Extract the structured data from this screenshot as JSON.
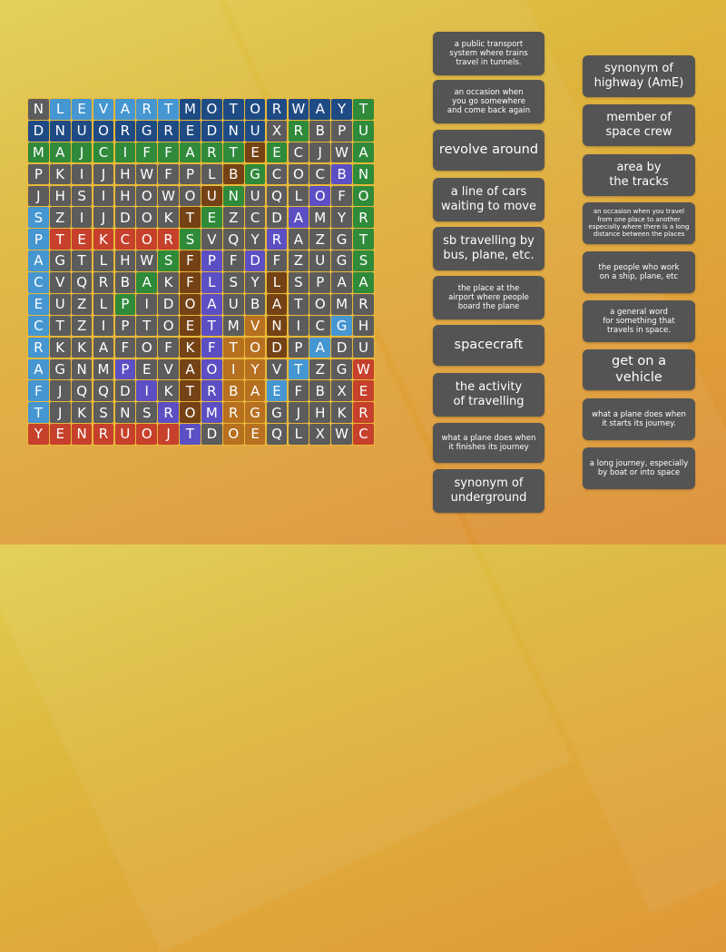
{
  "game": {
    "type": "wordsearch",
    "grid": [
      [
        "N",
        "L",
        "E",
        "V",
        "A",
        "R",
        "T",
        "M",
        "O",
        "T",
        "O",
        "R",
        "W",
        "A",
        "Y",
        "T"
      ],
      [
        "D",
        "N",
        "U",
        "O",
        "R",
        "G",
        "R",
        "E",
        "D",
        "N",
        "U",
        "X",
        "R",
        "B",
        "P",
        "U"
      ],
      [
        "M",
        "A",
        "J",
        "C",
        "I",
        "F",
        "F",
        "A",
        "R",
        "T",
        "E",
        "E",
        "C",
        "J",
        "W",
        "A"
      ],
      [
        "P",
        "K",
        "I",
        "J",
        "H",
        "W",
        "F",
        "P",
        "L",
        "B",
        "G",
        "C",
        "O",
        "C",
        "B",
        "N"
      ],
      [
        "J",
        "H",
        "S",
        "I",
        "H",
        "O",
        "W",
        "O",
        "U",
        "N",
        "U",
        "Q",
        "L",
        "O",
        "F",
        "O"
      ],
      [
        "S",
        "Z",
        "I",
        "J",
        "D",
        "O",
        "K",
        "T",
        "E",
        "Z",
        "C",
        "D",
        "A",
        "M",
        "Y",
        "R"
      ],
      [
        "P",
        "T",
        "E",
        "K",
        "C",
        "O",
        "R",
        "S",
        "V",
        "Q",
        "Y",
        "R",
        "A",
        "Z",
        "G",
        "T"
      ],
      [
        "A",
        "G",
        "T",
        "L",
        "H",
        "W",
        "S",
        "F",
        "P",
        "F",
        "D",
        "F",
        "Z",
        "U",
        "G",
        "S"
      ],
      [
        "C",
        "V",
        "Q",
        "R",
        "B",
        "A",
        "K",
        "F",
        "L",
        "S",
        "Y",
        "L",
        "S",
        "P",
        "A",
        "A"
      ],
      [
        "E",
        "U",
        "Z",
        "L",
        "P",
        "I",
        "D",
        "O",
        "A",
        "U",
        "B",
        "A",
        "T",
        "O",
        "M",
        "R"
      ],
      [
        "C",
        "T",
        "Z",
        "I",
        "P",
        "T",
        "O",
        "E",
        "T",
        "M",
        "V",
        "N",
        "I",
        "C",
        "G",
        "H"
      ],
      [
        "R",
        "K",
        "K",
        "A",
        "F",
        "O",
        "F",
        "K",
        "F",
        "T",
        "O",
        "D",
        "P",
        "A",
        "D",
        "U"
      ],
      [
        "A",
        "G",
        "N",
        "M",
        "P",
        "E",
        "V",
        "A",
        "O",
        "I",
        "Y",
        "V",
        "T",
        "Z",
        "G",
        "W"
      ],
      [
        "F",
        "J",
        "Q",
        "Q",
        "D",
        "I",
        "K",
        "T",
        "R",
        "B",
        "A",
        "E",
        "F",
        "B",
        "X",
        "E"
      ],
      [
        "T",
        "J",
        "K",
        "S",
        "N",
        "S",
        "R",
        "O",
        "M",
        "R",
        "G",
        "G",
        "J",
        "H",
        "K",
        "R"
      ],
      [
        "Y",
        "E",
        "N",
        "R",
        "U",
        "O",
        "J",
        "T",
        "D",
        "O",
        "E",
        "Q",
        "L",
        "X",
        "W",
        "C"
      ]
    ],
    "colors": [
      [
        "g",
        "lb",
        "lb",
        "lb",
        "lb",
        "lb",
        "lb",
        "db",
        "db",
        "db",
        "db",
        "db",
        "db",
        "db",
        "db",
        "gr"
      ],
      [
        "db",
        "db",
        "db",
        "db",
        "db",
        "db",
        "db",
        "db",
        "db",
        "db",
        "db",
        "g",
        "gr",
        "g",
        "g",
        "gr"
      ],
      [
        "gr",
        "gr",
        "gr",
        "gr",
        "gr",
        "gr",
        "gr",
        "gr",
        "gr",
        "gr",
        "br",
        "gr",
        "g",
        "g",
        "g",
        "gr"
      ],
      [
        "g",
        "g",
        "g",
        "g",
        "g",
        "g",
        "g",
        "g",
        "g",
        "br",
        "gr",
        "g",
        "g",
        "g",
        "pu",
        "gr"
      ],
      [
        "g",
        "g",
        "g",
        "g",
        "g",
        "g",
        "g",
        "g",
        "br",
        "gr",
        "g",
        "g",
        "g",
        "pu",
        "g",
        "gr"
      ],
      [
        "lb",
        "g",
        "g",
        "g",
        "g",
        "g",
        "g",
        "br",
        "gr",
        "g",
        "g",
        "g",
        "pu",
        "g",
        "g",
        "gr"
      ],
      [
        "lb",
        "red",
        "red",
        "red",
        "red",
        "red",
        "red",
        "gr",
        "g",
        "g",
        "g",
        "pu",
        "g",
        "g",
        "g",
        "gr"
      ],
      [
        "lb",
        "g",
        "g",
        "g",
        "g",
        "g",
        "gr",
        "br",
        "pu",
        "g",
        "pu",
        "g",
        "g",
        "g",
        "g",
        "gr"
      ],
      [
        "lb",
        "g",
        "g",
        "g",
        "g",
        "gr",
        "g",
        "br",
        "pu",
        "g",
        "g",
        "br",
        "g",
        "g",
        "g",
        "gr"
      ],
      [
        "lb",
        "g",
        "g",
        "g",
        "gr",
        "g",
        "g",
        "br",
        "pu",
        "g",
        "g",
        "br",
        "g",
        "g",
        "g",
        "g"
      ],
      [
        "lb",
        "g",
        "g",
        "g",
        "g",
        "g",
        "g",
        "br",
        "pu",
        "g",
        "or",
        "br",
        "g",
        "g",
        "lb",
        "g"
      ],
      [
        "lb",
        "g",
        "g",
        "g",
        "g",
        "g",
        "g",
        "br",
        "pu",
        "or",
        "or",
        "br",
        "g",
        "lb",
        "g",
        "g"
      ],
      [
        "lb",
        "g",
        "g",
        "g",
        "pu",
        "g",
        "g",
        "br",
        "pu",
        "or",
        "or",
        "g",
        "lb",
        "g",
        "g",
        "red"
      ],
      [
        "lb",
        "g",
        "g",
        "g",
        "g",
        "pu",
        "g",
        "br",
        "pu",
        "or",
        "or",
        "lb",
        "g",
        "g",
        "g",
        "red"
      ],
      [
        "lb",
        "g",
        "g",
        "g",
        "g",
        "g",
        "pu",
        "br",
        "pu",
        "or",
        "or",
        "g",
        "g",
        "g",
        "g",
        "red"
      ],
      [
        "red",
        "red",
        "red",
        "red",
        "red",
        "red",
        "red",
        "pu",
        "g",
        "or",
        "or",
        "g",
        "g",
        "g",
        "g",
        "red"
      ]
    ]
  },
  "clues_left": [
    {
      "text": "a public transport\nsystem where trains\ntravel in tunnels.",
      "size": "s"
    },
    {
      "text": "an occasion when\nyou go somewhere\nand come back again",
      "size": "s"
    },
    {
      "text": "revolve around",
      "size": "l"
    },
    {
      "text": "a line of cars\nwaiting to move",
      "size": "m"
    },
    {
      "text": "sb travelling by\nbus, plane, etc.",
      "size": "m"
    },
    {
      "text": "the place at the\nairport where people\nboard the plane",
      "size": "s"
    },
    {
      "text": "spacecraft",
      "size": "l"
    },
    {
      "text": "the activity\nof travelling",
      "size": "m"
    },
    {
      "text": "what a plane does when\nit finishes its journey",
      "size": "s"
    },
    {
      "text": "synonym of\nunderground",
      "size": "m"
    }
  ],
  "clues_right": [
    {
      "text": "synonym of\nhighway (AmE)",
      "size": "m"
    },
    {
      "text": "member of\nspace crew",
      "size": "m"
    },
    {
      "text": "area by\nthe tracks",
      "size": "m"
    },
    {
      "text": "an occasion when you travel\nfrom one place to another\nespecially where there is a long\ndistance between the places",
      "size": "xs"
    },
    {
      "text": "the people who work\non a ship, plane, etc",
      "size": "s"
    },
    {
      "text": "a general word\nfor something that\ntravels in space.",
      "size": "s"
    },
    {
      "text": "get on a vehicle",
      "size": "l"
    },
    {
      "text": "what a plane does when\nit starts its journey.",
      "size": "s"
    },
    {
      "text": "a long journey, especially\nby boat or into space",
      "size": "s"
    }
  ]
}
